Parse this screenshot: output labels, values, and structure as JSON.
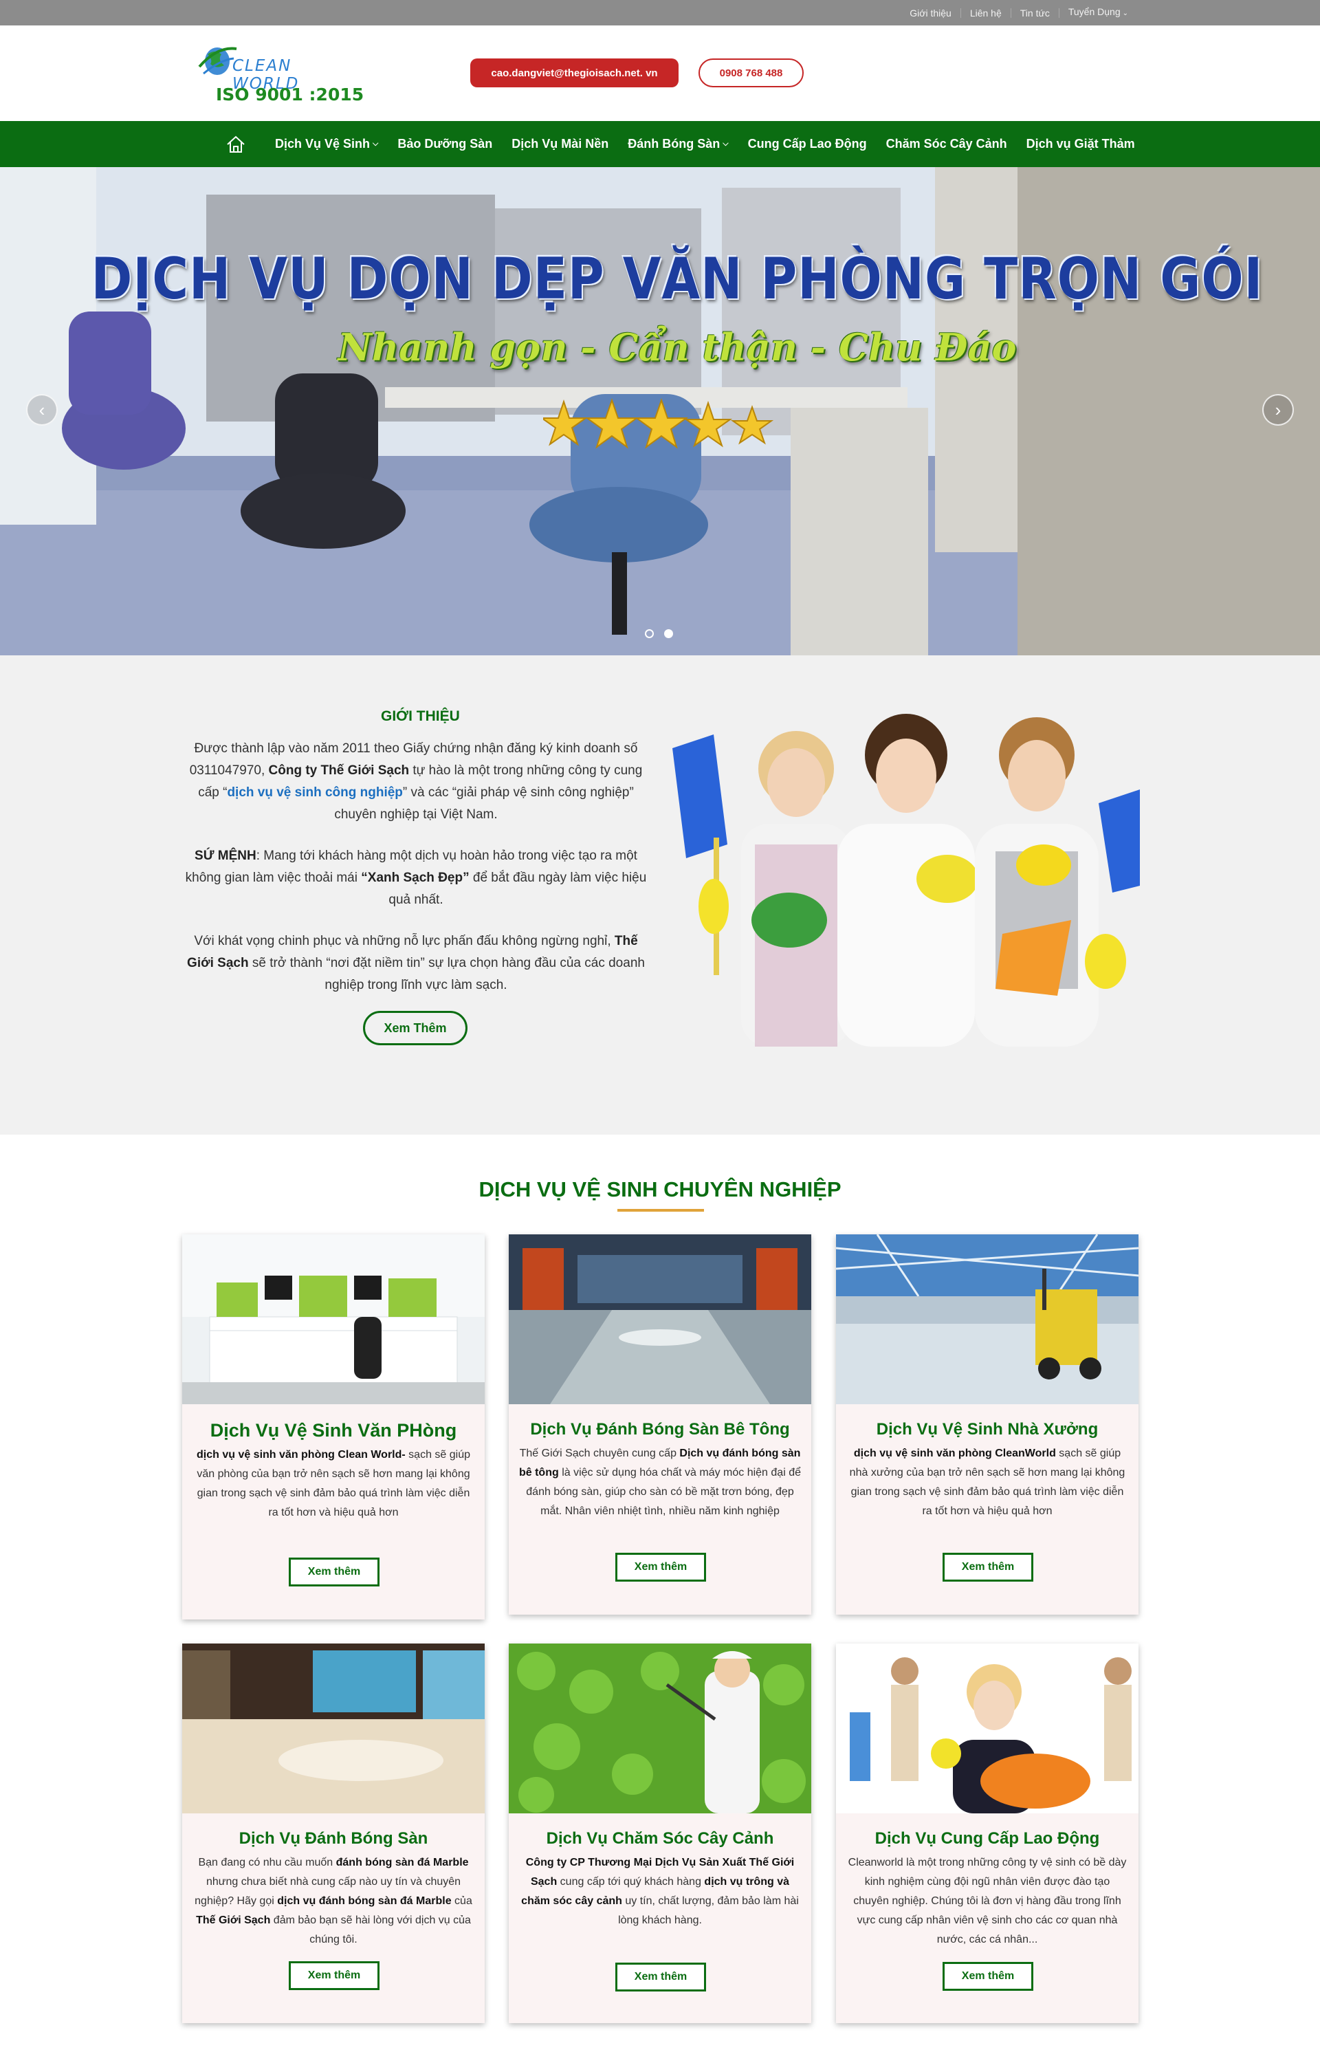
{
  "topbar": {
    "links": [
      "Giới thiệu",
      "Liên hệ",
      "Tin tức",
      "Tuyển Dụng"
    ]
  },
  "header": {
    "logo_text": "CLEAN WORLD",
    "logo_iso": "ISO 9001 :2015",
    "email": "cao.dangviet@thegioisach.net. vn",
    "phone": "0908 768 488"
  },
  "nav": {
    "items": [
      {
        "label": "Dịch Vụ Vệ Sinh",
        "dropdown": true
      },
      {
        "label": "Bảo Dưỡng Sàn",
        "dropdown": false
      },
      {
        "label": "Dịch Vụ Mài Nền",
        "dropdown": false
      },
      {
        "label": "Đánh Bóng Sàn",
        "dropdown": true
      },
      {
        "label": "Cung Cấp Lao Động",
        "dropdown": false
      },
      {
        "label": "Chăm Sóc Cây Cảnh",
        "dropdown": false
      },
      {
        "label": "Dịch vụ Giặt Thảm",
        "dropdown": false
      }
    ]
  },
  "hero": {
    "title": "DỊCH VỤ DỌN DẸP VĂN PHÒNG TRỌN GÓI",
    "subtitle": "Nhanh gọn - Cẩn thận - Chu Đáo",
    "active_slide": 2,
    "slide_count": 2
  },
  "intro": {
    "heading": "GIỚI THIỆU",
    "p1_a": "Được thành lập vào năm 2011 theo Giấy chứng nhận đăng ký kinh doanh số 0311047970, ",
    "p1_b": "Công ty Thế Giới Sạch",
    "p1_c": " tự hào là một trong những công ty cung cấp “",
    "p1_link": "dịch vụ vệ sinh công nghiệp",
    "p1_d": "” và các “giải pháp vệ sinh công nghiệp” chuyên nghiệp tại Việt Nam.",
    "p2_a": "SỨ MỆNH",
    "p2_b": ": Mang tới khách hàng một dịch vụ hoàn hảo trong việc tạo ra một không gian làm việc thoải mái ",
    "p2_c": "“Xanh Sạch Đẹp”",
    "p2_d": " để bắt đầu ngày làm việc hiệu quả nhất.",
    "p3_a": "Với khát vọng chinh phục và những nỗ lực phấn đấu không ngừng nghỉ, ",
    "p3_b": "Thế Giới Sạch",
    "p3_c": " sẽ trở thành “nơi đặt niềm tin” sự lựa chọn hàng đầu của các doanh nghiệp trong lĩnh vực làm sạch.",
    "button": "Xem Thêm"
  },
  "services": {
    "title": "DỊCH VỤ VỆ SINH CHUYÊN NGHIỆP",
    "cards": [
      {
        "title": "Dịch Vụ Vệ Sinh Văn PHòng",
        "t1": "dịch vụ vệ sinh văn phòng Clean World-",
        "t2": " sạch sẽ giúp văn phòng của bạn trở nên sạch sẽ hơn mang lại không gian trong sạch vệ sinh đảm bảo quá trình làm việc diễn ra tốt hơn và hiệu quả hơn",
        "button": "Xem thêm"
      },
      {
        "title": "Dịch Vụ Đánh Bóng Sàn Bê Tông",
        "t1": "Thế Giới Sạch chuyên cung cấp ",
        "t2": "Dịch vụ đánh bóng sàn bê tông",
        "t3": " là việc sử dụng hóa chất và máy móc hiện đại để đánh bóng sàn, giúp cho sàn có bề mặt trơn bóng, đẹp mắt. Nhân viên nhiệt tình, nhiều năm kinh nghiệp",
        "button": "Xem thêm"
      },
      {
        "title": "Dịch Vụ Vệ Sinh Nhà Xưởng",
        "t1": "dịch vụ vệ sinh văn phòng CleanWorld",
        "t2": " sạch sẽ giúp nhà xưởng của bạn trở nên sạch sẽ hơn mang lại không gian trong sạch vệ sinh đảm bảo quá trình làm việc diễn ra tốt hơn và hiệu quả hơn",
        "button": "Xem thêm"
      },
      {
        "title": "Dịch Vụ Đánh Bóng Sàn",
        "t1": "Bạn đang có nhu cầu muốn ",
        "t2": "đánh bóng sàn đá Marble",
        "t3": " nhưng chưa biết nhà cung cấp nào uy tín và chuyên nghiệp? Hãy gọi ",
        "t4": "dịch vụ đánh bóng sàn đá Marble",
        "t5": " của ",
        "t6": "Thế Giới Sạch",
        "t7": " đảm bảo bạn sẽ hài lòng với dịch vụ của chúng tôi.",
        "button": "Xem thêm"
      },
      {
        "title": "Dịch Vụ Chăm Sóc Cây Cảnh",
        "t1": "Công ty CP Thương Mại Dịch Vụ Sản Xuất Thế Giới Sạch",
        "t2": " cung cấp tới quý khách hàng ",
        "t3": "dịch vụ trông và chăm sóc cây cảnh",
        "t4": " uy tín, chất lượng, đảm bảo làm hài lòng khách hàng.",
        "button": "Xem thêm"
      },
      {
        "title": "Dịch Vụ Cung Cấp Lao Động",
        "t1": "Cleanworld là một trong những công ty vệ sinh có bề dày kinh nghiệm  cùng đội ngũ nhân viên được đào tạo chuyên nghiệp. Chúng tôi là đơn vị hàng đầu trong lĩnh vực cung cấp nhân viên vệ sinh cho các cơ quan nhà nước, các cá nhân...",
        "button": "Xem thêm"
      }
    ]
  },
  "colors": {
    "nav_green": "#0b6d12",
    "accent_red": "#c62626",
    "underline_orange": "#e0a33a",
    "topbar_gray": "#8c8c8c"
  }
}
